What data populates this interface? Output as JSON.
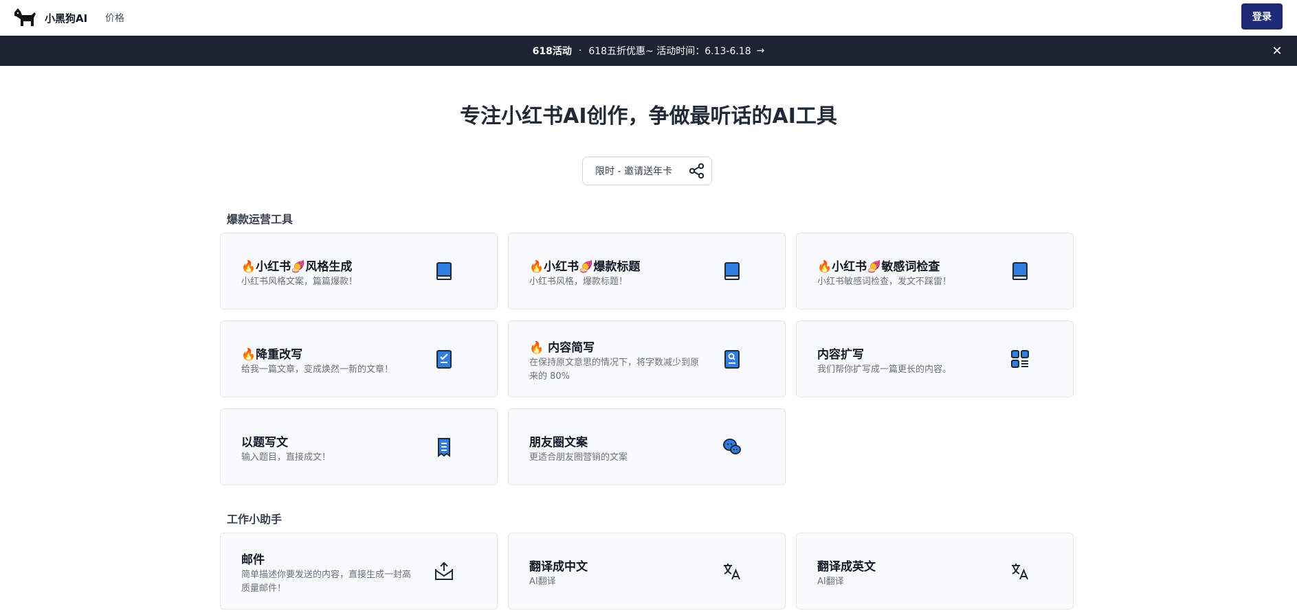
{
  "header": {
    "brand": "小黑狗AI",
    "nav_price": "价格",
    "login": "登录"
  },
  "banner": {
    "event": "618活动",
    "separator": "·",
    "text": "618五折优惠~ 活动时间：6.13-6.18",
    "arrow": "→",
    "close": "✕"
  },
  "hero": {
    "title": "专注小红书AI创作，争做最听话的AI工具",
    "invite": "限时 - 邀请送年卡"
  },
  "sections": [
    {
      "title": "爆款运营工具",
      "cards": [
        {
          "title": "🔥小红书🍠风格生成",
          "desc": "小红书风格文案，篇篇爆款！",
          "icon": "book-icon"
        },
        {
          "title": "🔥小红书🍠爆款标题",
          "desc": "小红书风格，爆款标题！",
          "icon": "book-icon"
        },
        {
          "title": "🔥小红书🍠敏感词检查",
          "desc": "小红书敏感词检查，发文不踩雷！",
          "icon": "book-icon"
        },
        {
          "title": "🔥降重改写",
          "desc": "给我一篇文章，变成焕然一新的文章！",
          "icon": "clipboard-check-icon"
        },
        {
          "title": "🔥 内容简写",
          "desc": "在保持原文意思的情况下，将字数减少到原来的 80%",
          "icon": "document-search-icon"
        },
        {
          "title": "内容扩写",
          "desc": "我们帮你扩写成一篇更长的内容。",
          "icon": "grid-list-icon"
        },
        {
          "title": "以题写文",
          "desc": "输入题目，直接成文！",
          "icon": "receipt-icon"
        },
        {
          "title": "朋友圈文案",
          "desc": "更适合朋友圈营销的文案",
          "icon": "chat-bubbles-icon"
        }
      ]
    },
    {
      "title": "工作小助手",
      "cards": [
        {
          "title": "邮件",
          "desc": "简单描述你要发送的内容，直接生成一封高质量邮件！",
          "icon": "mail-send-icon"
        },
        {
          "title": "翻译成中文",
          "desc": "AI翻译",
          "icon": "translate-icon"
        },
        {
          "title": "翻译成英文",
          "desc": "AI翻译",
          "icon": "translate-icon"
        }
      ]
    }
  ]
}
